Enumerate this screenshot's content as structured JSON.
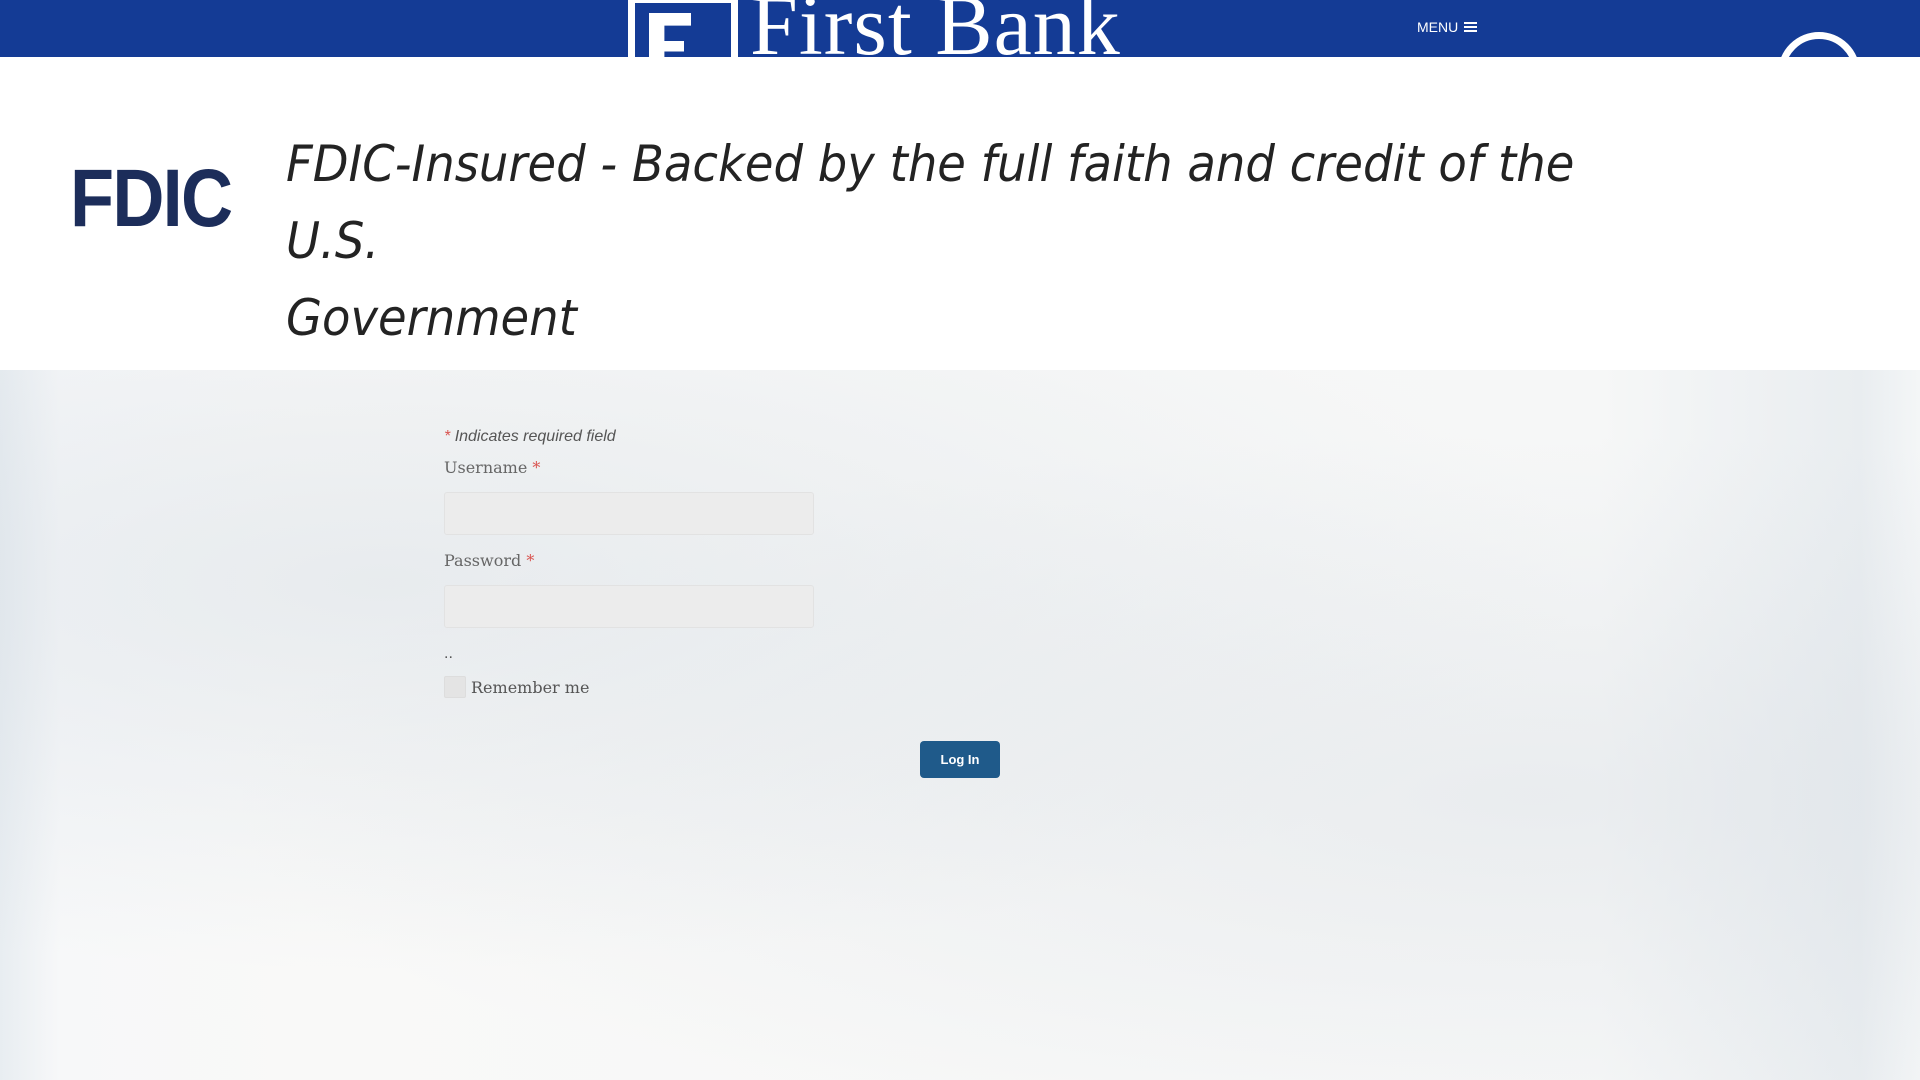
{
  "header": {
    "brand_name": "First Bank",
    "menu_label": "MENU"
  },
  "fdic_banner": {
    "logo_text": "FDIC",
    "line1": "FDIC-Insured - Backed by the full faith and credit of the U.S.",
    "line2": "Government"
  },
  "login_form": {
    "required_star": "*",
    "required_note": "Indicates required field",
    "username_label": "Username",
    "password_label": "Password",
    "dots": "..",
    "remember_label": "Remember me",
    "submit_label": "Log In"
  },
  "colors": {
    "header_bg": "#143b95",
    "button_bg": "#1f5a8a",
    "required_star": "#d9534f",
    "fdic_logo": "#1c2d5a"
  },
  "icons": {
    "menu": "hamburger-icon",
    "user": "user-circle-icon",
    "logo": "bank-logo-mark"
  }
}
